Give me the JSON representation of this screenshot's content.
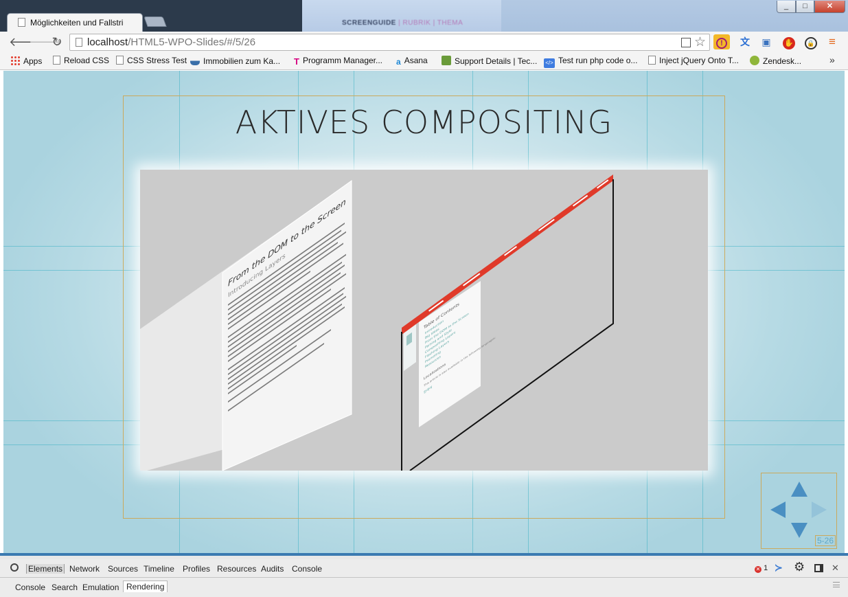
{
  "browser": {
    "tab_title": "Möglichkeiten und Fallstri",
    "url_host": "localhost",
    "url_path": "/HTML5-WPO-Slides/#/5/26",
    "background_text": {
      "a": "SCREENGUIDE",
      "b": "| RUBRIK",
      "c": "| THEMA"
    },
    "bookmarks": [
      {
        "label": "Apps",
        "icon": "apps-grid-icon"
      },
      {
        "label": "Reload CSS",
        "icon": "page-icon"
      },
      {
        "label": "CSS Stress Test",
        "icon": "page-icon"
      },
      {
        "label": "Immobilien zum Ka...",
        "icon": "boat-icon"
      },
      {
        "label": "Programm Manager...",
        "icon": "telekom-icon"
      },
      {
        "label": "Asana",
        "icon": "asana-icon"
      },
      {
        "label": "Support Details | Tec...",
        "icon": "support-icon"
      },
      {
        "label": "Test run php code o...",
        "icon": "code-icon"
      },
      {
        "label": "Inject jQuery Onto T...",
        "icon": "page-icon"
      },
      {
        "label": "Zendesk...",
        "icon": "zendesk-icon"
      }
    ],
    "bookmarks_more": "»",
    "window_buttons": {
      "minimize": "_",
      "maximize": "□",
      "close": "✕"
    }
  },
  "slide": {
    "title": "AKTIVES COMPOSITING",
    "slide_number": "5-26",
    "demo": {
      "article_heading": "From the DOM to the Screen",
      "article_subheading": "Introducing Layers",
      "toc_heading": "Table of Contents",
      "toc_items": [
        "Introduction",
        "Big Ideas",
        "From the DOM to the Screen",
        "Parsing and Style",
        "Compositing Layers",
        "Flashing Layers",
        "Promoting",
        "Resources"
      ],
      "toc_extra": [
        "Localizations",
        "This article is also available in the following languages:",
        "한국어"
      ]
    },
    "colors": {
      "accent_red": "#e03a2a",
      "nav_arrow": "#4a8fc2",
      "frame_gold": "#caa95c",
      "grid_teal": "#2aaabe"
    }
  },
  "devtools": {
    "tabs": [
      "Elements",
      "Network",
      "Sources",
      "Timeline",
      "Profiles",
      "Resources",
      "Audits",
      "Console"
    ],
    "active_tab": "Elements",
    "error_count": "1",
    "drawer_tabs": [
      "Console",
      "Search",
      "Emulation",
      "Rendering"
    ],
    "active_drawer_tab": "Rendering"
  }
}
